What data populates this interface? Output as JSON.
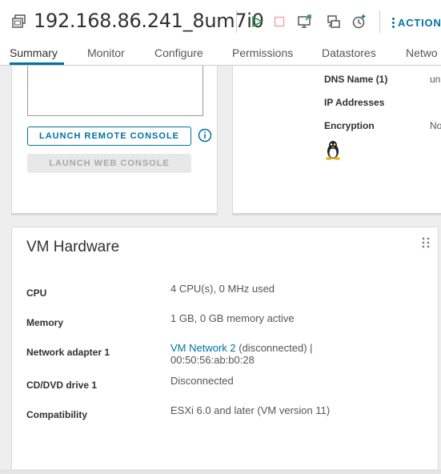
{
  "header": {
    "title": "192.168.86.241_8um7i0",
    "actions_label": "ACTION",
    "icons": [
      "vm-icon",
      "power-on-icon",
      "power-off-icon",
      "launch-console-icon",
      "migrate-icon",
      "snapshot-icon",
      "actions-menu-icon"
    ],
    "colors": {
      "accent": "#0072a3",
      "power_on": "#2e9a4e",
      "power_off": "#f2a8a8"
    }
  },
  "tabs": [
    {
      "label": "Summary",
      "active": true
    },
    {
      "label": "Monitor"
    },
    {
      "label": "Configure"
    },
    {
      "label": "Permissions"
    },
    {
      "label": "Datastores"
    },
    {
      "label": "Netwo"
    }
  ],
  "console": {
    "launch_remote_label": "LAUNCH REMOTE CONSOLE",
    "launch_web_label": "LAUNCH WEB CONSOLE"
  },
  "guest_info": {
    "rows": [
      {
        "key": "DNS Name (1)",
        "value": "un"
      },
      {
        "key": "IP Addresses",
        "value": ""
      },
      {
        "key": "Encryption",
        "value": "No"
      }
    ],
    "os_icon": "linux-tux-icon"
  },
  "vm_hardware": {
    "title": "VM Hardware",
    "rows": [
      {
        "key": "CPU",
        "value": "4 CPU(s), 0 MHz used"
      },
      {
        "key": "Memory",
        "value": "1 GB, 0 GB memory active"
      },
      {
        "key": "Network adapter 1",
        "link": "VM Network 2",
        "value": " (disconnected) |",
        "value2": "00:50:56:ab:b0:28"
      },
      {
        "key": "CD/DVD drive 1",
        "value": "Disconnected"
      },
      {
        "key": "Compatibility",
        "value": "ESXi 6.0 and later (VM version 11)"
      }
    ]
  }
}
